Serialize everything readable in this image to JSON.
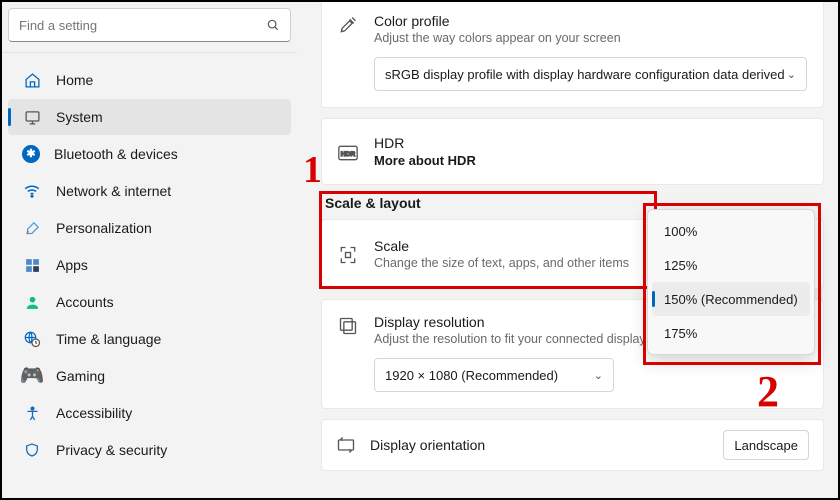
{
  "sidebar": {
    "search_placeholder": "Find a setting",
    "items": [
      {
        "label": "Home"
      },
      {
        "label": "System"
      },
      {
        "label": "Bluetooth & devices"
      },
      {
        "label": "Network & internet"
      },
      {
        "label": "Personalization"
      },
      {
        "label": "Apps"
      },
      {
        "label": "Accounts"
      },
      {
        "label": "Time & language"
      },
      {
        "label": "Gaming"
      },
      {
        "label": "Accessibility"
      },
      {
        "label": "Privacy & security"
      }
    ]
  },
  "content": {
    "color_profile": {
      "title": "Color profile",
      "desc": "Adjust the way colors appear on your screen",
      "value": "sRGB display profile with display hardware configuration data derived fron"
    },
    "hdr": {
      "title": "HDR",
      "link": "More about HDR"
    },
    "section_head": "Scale & layout",
    "scale": {
      "title": "Scale",
      "desc": "Change the size of text, apps, and other items",
      "options": [
        "100%",
        "125%",
        "150% (Recommended)",
        "175%"
      ],
      "selected_index": 2
    },
    "resolution": {
      "title": "Display resolution",
      "desc": "Adjust the resolution to fit your connected display",
      "value": "1920 × 1080 (Recommended)"
    },
    "orientation": {
      "title": "Display orientation",
      "value": "Landscape"
    }
  },
  "annotations": {
    "one": "1",
    "two": "2"
  }
}
